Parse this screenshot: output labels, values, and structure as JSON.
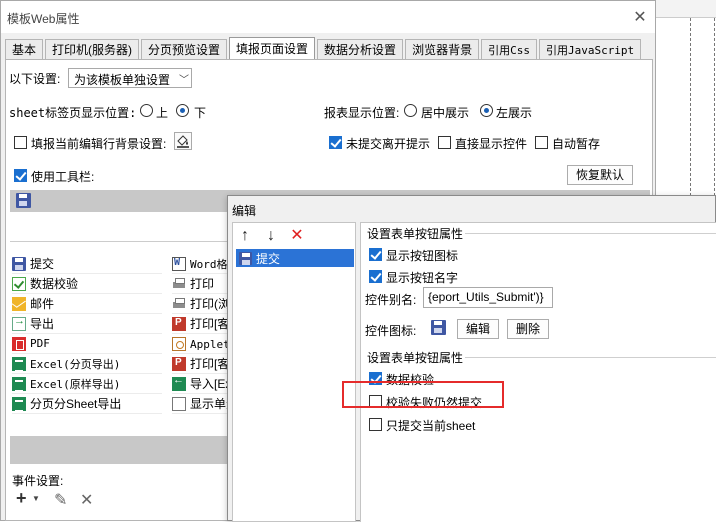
{
  "dialog": {
    "title": "模板Web属性",
    "close_glyph": "✕"
  },
  "tabs": [
    {
      "label": "基本"
    },
    {
      "label": "打印机(服务器)"
    },
    {
      "label": "分页预览设置"
    },
    {
      "label": "填报页面设置"
    },
    {
      "label": "数据分析设置"
    },
    {
      "label": "浏览器背景"
    },
    {
      "label": "引用Css"
    },
    {
      "label": "引用JavaScript"
    }
  ],
  "settings": {
    "apply_label": "以下设置:",
    "apply_value": "为该模板单独设置",
    "sheet_tab_label": "sheet标签页显示位置:",
    "sheet_tab_options": [
      "上",
      "下"
    ],
    "report_pos_label": "报表显示位置:",
    "report_pos_options": [
      "居中展示",
      "左展示"
    ],
    "fill_bg_label": "填报当前编辑行背景设置:",
    "unsubmitted_label": "未提交离开提示",
    "direct_control_label": "直接显示控件",
    "autosave_label": "自动暂存",
    "use_toolbar_label": "使用工具栏:",
    "restore_default_label": "恢复默认"
  },
  "toolbar_items": {
    "left": [
      {
        "label": "提交",
        "icon": "save-icon"
      },
      {
        "label": "数据校验",
        "icon": "check-icon"
      },
      {
        "label": "邮件",
        "icon": "mail-icon"
      },
      {
        "label": "导出",
        "icon": "export-icon"
      },
      {
        "label": "PDF",
        "icon": "pdf-icon"
      },
      {
        "label": "Excel(分页导出)",
        "icon": "excel-icon"
      },
      {
        "label": "Excel(原样导出)",
        "icon": "excel-icon"
      },
      {
        "label": "分页分Sheet导出",
        "icon": "excel-icon"
      }
    ],
    "right": [
      {
        "label": "Word格式",
        "icon": "word-icon"
      },
      {
        "label": "打印",
        "icon": "print-icon"
      },
      {
        "label": "打印(浏",
        "icon": "print-icon"
      },
      {
        "label": "打印[客",
        "icon": "print-red-icon"
      },
      {
        "label": "Applet打",
        "icon": "applet-icon"
      },
      {
        "label": "打印[客",
        "icon": "print-red-icon"
      },
      {
        "label": "导入[Ex",
        "icon": "import-icon"
      },
      {
        "label": "显示单元",
        "icon": "cell-icon"
      }
    ]
  },
  "events": {
    "label": "事件设置:",
    "add_glyph": "+",
    "edit_glyph": "✎",
    "delete_glyph": "✕"
  },
  "edit_dialog": {
    "title": "编辑",
    "up_glyph": "↑",
    "down_glyph": "↓",
    "delete_glyph": "✕",
    "list_item": "提交",
    "group1_title": "设置表单按钮属性",
    "show_icon_label": "显示按钮图标",
    "show_name_label": "显示按钮名字",
    "alias_label": "控件别名:",
    "alias_value": "{eport_Utils_Submit')}",
    "icon_label": "控件图标:",
    "edit_button": "编辑",
    "delete_button": "删除",
    "group2_title": "设置表单按钮属性",
    "data_check_label": "数据校验",
    "fail_submit_label": "校验失败仍然提交",
    "current_sheet_label": "只提交当前sheet"
  }
}
